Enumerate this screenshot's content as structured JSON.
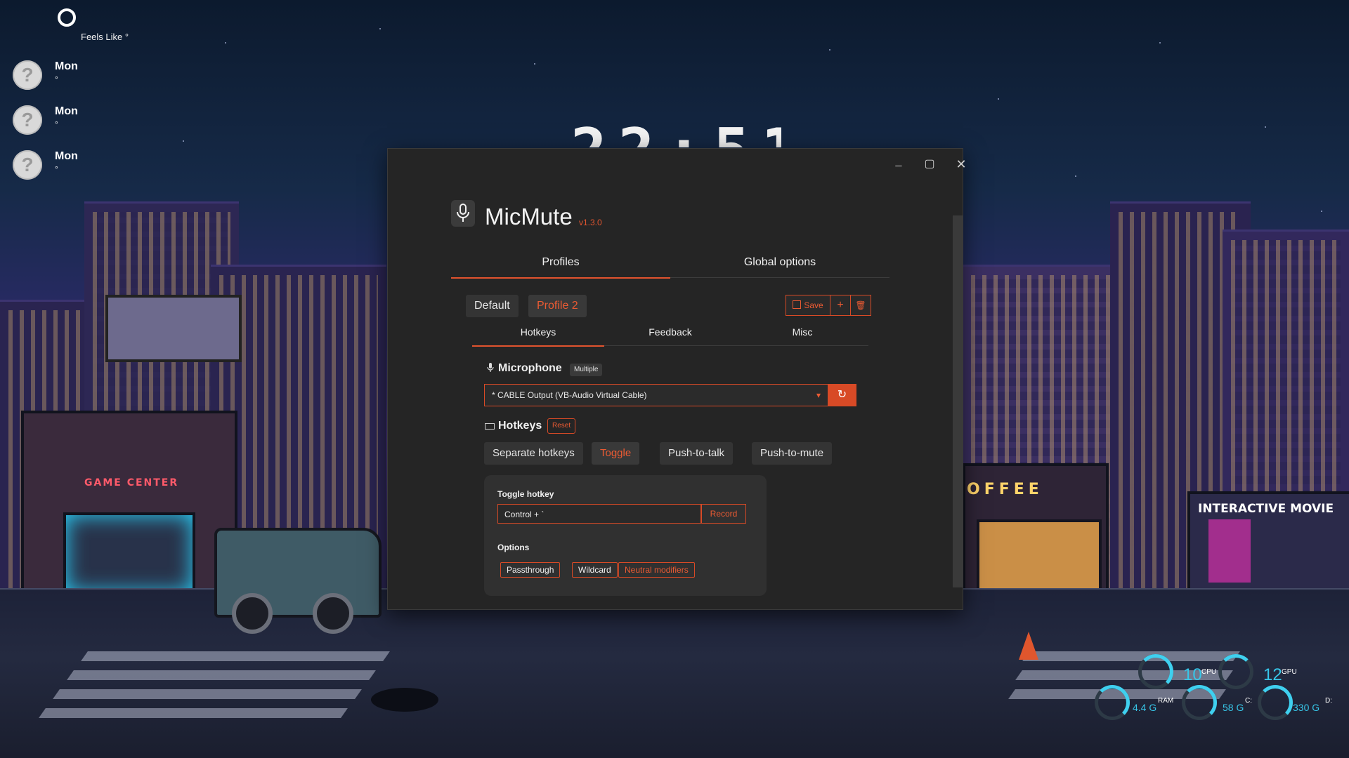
{
  "desktop": {
    "clock_text": "22:51",
    "weather": {
      "temp_symbol": "°",
      "feels_like": "Feels Like °",
      "forecast": [
        {
          "day": "Mon",
          "deg": "°",
          "icon": "?"
        },
        {
          "day": "Mon",
          "deg": "°",
          "icon": "?"
        },
        {
          "day": "Mon",
          "deg": "°",
          "icon": "?"
        }
      ]
    },
    "sysmon": {
      "cpu_value": "10",
      "cpu_label": "CPU",
      "gpu_value": "12",
      "gpu_label": "GPU",
      "ram_value": "4.4 G",
      "ram_label": "RAM",
      "c_value": "58 G",
      "c_label": "C:",
      "d_value": "330 G",
      "d_label": "D:"
    },
    "signs": {
      "game_center": "GAME CENTER",
      "coffee": "OFFEE",
      "interactive_movie": "INTERACTIVE MOVIE"
    }
  },
  "window": {
    "controls": {
      "minimize": "_",
      "maximize": "▢",
      "close": "✕"
    },
    "app_name": "MicMute",
    "version": "v1.3.0",
    "main_tabs": [
      "Profiles",
      "Global options"
    ],
    "active_main_tab": "Profiles",
    "profiles": [
      "Default",
      "Profile 2"
    ],
    "active_profile": "Profile 2",
    "profile_actions": {
      "save": "Save",
      "add": "+",
      "delete": "🗑"
    },
    "sub_tabs": [
      "Hotkeys",
      "Feedback",
      "Misc"
    ],
    "active_sub_tab": "Hotkeys",
    "microphone": {
      "title": "Microphone",
      "badge": "Multiple",
      "selected": "* CABLE Output (VB-Audio Virtual Cable)",
      "refresh_icon": "↻"
    },
    "hotkeys": {
      "title": "Hotkeys",
      "reset": "Reset",
      "modes": [
        "Separate hotkeys",
        "Toggle",
        "Push-to-talk",
        "Push-to-mute"
      ],
      "active_mode": "Toggle",
      "toggle_hotkey_label": "Toggle hotkey",
      "toggle_hotkey_value": "Control + `",
      "record": "Record",
      "options_label": "Options",
      "options": [
        {
          "label": "Passthrough",
          "on": false
        },
        {
          "label": "Wildcard",
          "on": false
        },
        {
          "label": "Neutral modifiers",
          "on": true
        }
      ]
    },
    "accent_color": "#e2532e"
  }
}
